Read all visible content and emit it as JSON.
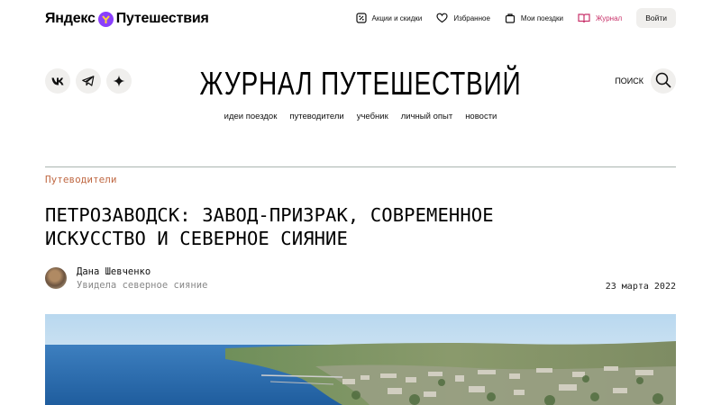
{
  "header": {
    "logo_text_1": "Яндекс",
    "logo_text_2": "Путешествия",
    "nav": [
      {
        "label": "Акции и скидки",
        "icon": "discount-icon"
      },
      {
        "label": "Избранное",
        "icon": "heart-icon"
      },
      {
        "label": "Мои поездки",
        "icon": "bag-icon"
      },
      {
        "label": "Журнал",
        "icon": "book-icon"
      }
    ],
    "login_label": "Войти",
    "accent_color": "#c8326a"
  },
  "social": [
    {
      "icon": "vk-icon"
    },
    {
      "icon": "telegram-icon"
    },
    {
      "icon": "sparkle-icon"
    }
  ],
  "masthead": {
    "title": "ЖУРНАЛ ПУТЕШЕСТВИЙ",
    "search_label": "ПОИСК"
  },
  "sections": [
    "идеи поездок",
    "путеводители",
    "учебник",
    "личный опыт",
    "новости"
  ],
  "article": {
    "category": "Путеводители",
    "title_line1": "ПЕТРОЗАВОДСК: ЗАВОД-ПРИЗРАК, СОВРЕМЕННОЕ",
    "title_line2": "ИСКУССТВО И СЕВЕРНОЕ СИЯНИЕ",
    "author_name": "Дана Шевченко",
    "author_note": "Увидела северное сияние",
    "date": "23 марта 2022",
    "category_color": "#c06a45"
  }
}
